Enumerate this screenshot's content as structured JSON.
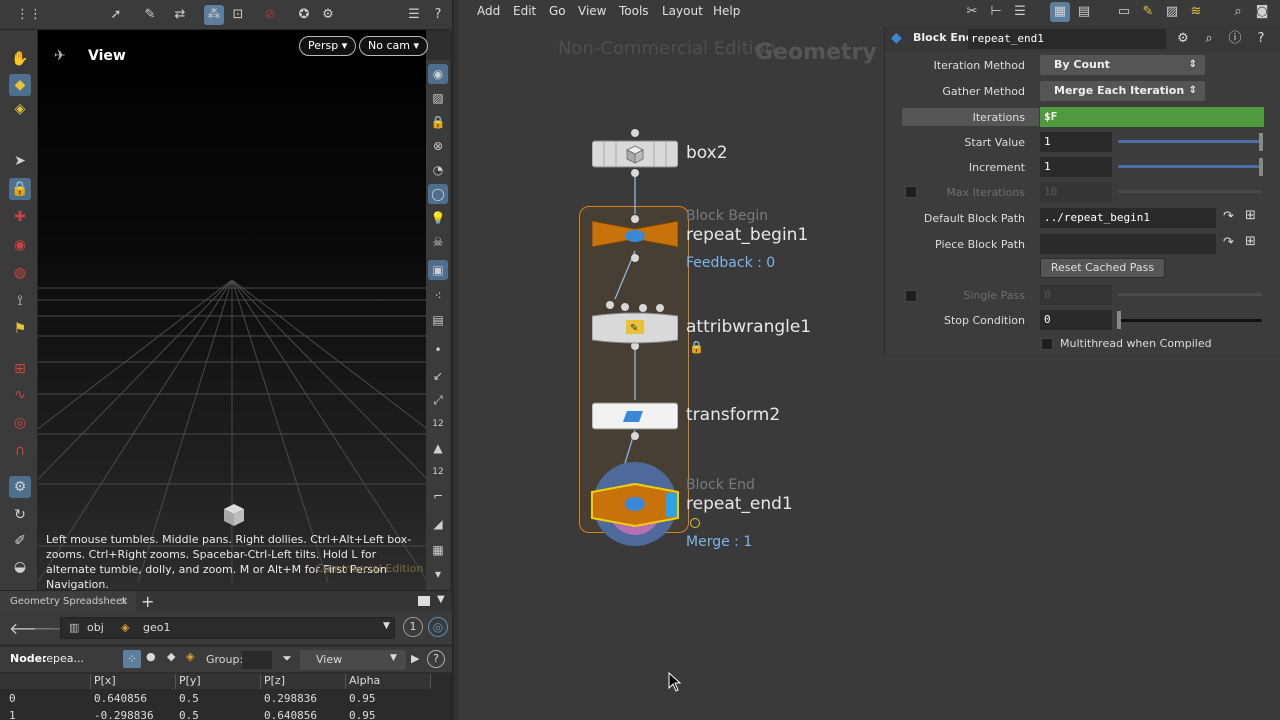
{
  "viewer": {
    "title": "View",
    "persp_label": "Persp ▾",
    "cam_label": "No cam ▾",
    "help_text": "Left mouse tumbles. Middle pans. Right dollies. Ctrl+Alt+Left box-zooms. Ctrl+Right zooms. Spacebar-Ctrl-Left tilts. Hold L for alternate tumble, dolly, and zoom. M or Alt+M for First Person Navigation.",
    "watermark": "Commercial Edition"
  },
  "spreadsheet": {
    "tab_label": "Geometry Spreadsheet",
    "tab_close": "×",
    "add_tab": "+",
    "path": [
      "obj",
      "geo1"
    ],
    "badge": "1",
    "node_label": "Node:",
    "node_value": "repea...",
    "group_label": "Group:",
    "view_label": "View",
    "columns": [
      "",
      "P[x]",
      "P[y]",
      "P[z]",
      "Alpha"
    ],
    "rows": [
      [
        "0",
        "0.640856",
        "0.5",
        "0.298836",
        "0.95"
      ],
      [
        "1",
        "-0.298836",
        "0.5",
        "0.640856",
        "0.95"
      ]
    ]
  },
  "menubar": [
    "Add",
    "Edit",
    "Go",
    "View",
    "Tools",
    "Layout",
    "Help"
  ],
  "network": {
    "watermark": "Non-Commercial Edition",
    "context": "Geometry",
    "nodes": {
      "box2": "box2",
      "block_begin_sub": "Block Begin",
      "repeat_begin1": "repeat_begin1",
      "feedback": "Feedback : 0",
      "attribwrangle1": "attribwrangle1",
      "transform2": "transform2",
      "block_end_sub": "Block End",
      "repeat_end1": "repeat_end1",
      "merge": "Merge : 1"
    }
  },
  "params": {
    "node_type": "Block End",
    "node_name": "repeat_end1",
    "iteration_method_label": "Iteration Method",
    "iteration_method_value": "By Count",
    "gather_method_label": "Gather Method",
    "gather_method_value": "Merge Each Iteration",
    "iterations_label": "Iterations",
    "iterations_value": "$F",
    "start_value_label": "Start Value",
    "start_value": "1",
    "increment_label": "Increment",
    "increment_value": "1",
    "max_iterations_label": "Max Iterations",
    "max_iterations_value": "10",
    "default_block_path_label": "Default Block Path",
    "default_block_path_value": "../repeat_begin1",
    "piece_block_path_label": "Piece Block Path",
    "piece_block_path_value": "",
    "reset_button": "Reset Cached Pass",
    "single_pass_label": "Single Pass",
    "single_pass_value": "0",
    "stop_condition_label": "Stop Condition",
    "stop_condition_value": "0",
    "multithread_label": "Multithread when Compiled"
  },
  "colors": {
    "accent_green": "#4e9a3c",
    "node_orange": "#c8720c",
    "block_outline": "#d9821a",
    "link_blue": "#7fb5e8"
  }
}
